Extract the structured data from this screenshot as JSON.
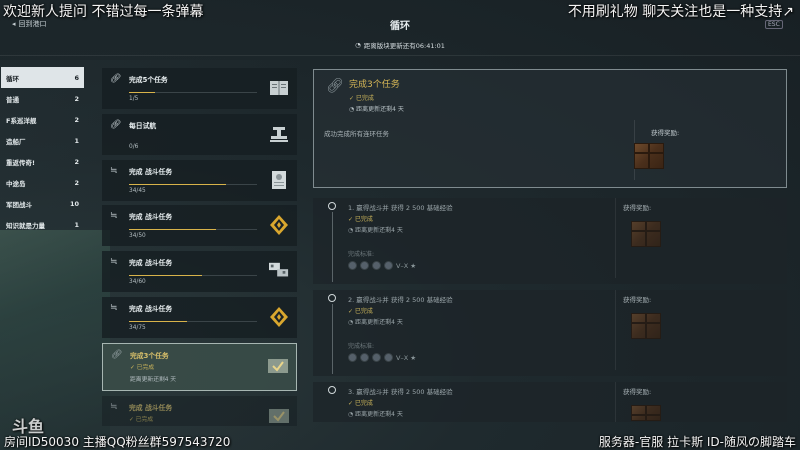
{
  "stream_overlay": {
    "top_left": "欢迎新人提问 不错过每一条弹幕",
    "top_right": "不用刷礼物 聊天关注也是一种支持↗",
    "bottom_left": "房间ID50030 主播QQ粉丝群597543720",
    "bottom_right": "服务器-官服 拉卡斯 ID-随风の脚踏车",
    "logo": "斗鱼"
  },
  "header": {
    "back_label": "回到港口",
    "title": "循环",
    "timer": "距离版块更新还有06:41:01",
    "esc_tag": "ESC"
  },
  "categories": [
    {
      "label": "循环",
      "count": "6",
      "active": true
    },
    {
      "label": "普通",
      "count": "2"
    },
    {
      "label": "F系巡洋舰",
      "count": "2"
    },
    {
      "label": "造船厂",
      "count": "1"
    },
    {
      "label": "重返传奇!",
      "count": "2"
    },
    {
      "label": "中途岛",
      "count": "2"
    },
    {
      "label": "军团战斗",
      "count": "10"
    },
    {
      "label": "知识就是力量",
      "count": "1"
    }
  ],
  "task_cards": [
    {
      "icon": "link-icon",
      "title": "完成5个任务",
      "progress": "1/5",
      "fill": 0.2,
      "reward": "book-icon"
    },
    {
      "icon": "link-icon",
      "title": "每日试航",
      "progress": "0/6",
      "fill": 0,
      "reward": "anchor-stack-icon"
    },
    {
      "icon": "flag-icon",
      "title": "完成 战斗任务",
      "progress": "34/45",
      "fill": 0.76,
      "reward": "document-icon"
    },
    {
      "icon": "flag-icon",
      "title": "完成 战斗任务",
      "progress": "34/50",
      "fill": 0.68,
      "reward": "gold-ribbon-icon"
    },
    {
      "icon": "flag-icon",
      "title": "完成 战斗任务",
      "progress": "34/60",
      "fill": 0.57,
      "reward": "flags-icon"
    },
    {
      "icon": "flag-icon",
      "title": "完成 战斗任务",
      "progress": "34/75",
      "fill": 0.45,
      "reward": "gold-ribbon-icon"
    }
  ],
  "selected_card": {
    "title": "完成3个任务",
    "done": "✓ 已完成",
    "time": "距离更新还剩4 天"
  },
  "last_card": {
    "title": "完成 战斗任务",
    "done": "✓ 已完成"
  },
  "detail": {
    "title": "完成3个任务",
    "done": "✓ 已完成",
    "time": "距离更新还剩4 天",
    "description": "成功完成所有连环任务",
    "reward_label": "获得奖励:"
  },
  "subtasks": [
    {
      "title": "1. 赢得战斗并 获得 2 500 基础经验",
      "done": "✓ 已完成",
      "time": "距离更新还剩4 天",
      "cond": "完成标准:",
      "req": "V–X ★",
      "reward_label": "获得奖励:"
    },
    {
      "title": "2. 赢得战斗并 获得 2 500 基础经验",
      "done": "✓ 已完成",
      "time": "距离更新还剩4 天",
      "cond": "完成标准:",
      "req": "V–X ★",
      "reward_label": "获得奖励:"
    },
    {
      "title": "3. 赢得战斗并 获得 2 500 基础经验",
      "done": "✓ 已完成",
      "time": "",
      "cond": "",
      "req": "",
      "reward_label": "获得奖励:"
    }
  ]
}
